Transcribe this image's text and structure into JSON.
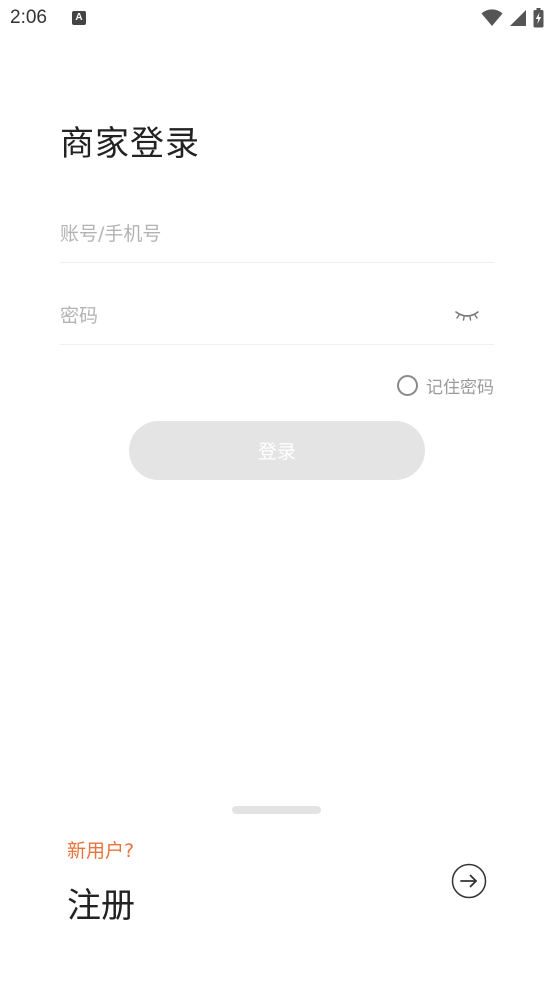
{
  "status_bar": {
    "time": "2:06",
    "notification_icon": "A"
  },
  "title": "商家登录",
  "account_field": {
    "placeholder": "账号/手机号",
    "value": ""
  },
  "password_field": {
    "placeholder": "密码",
    "value": ""
  },
  "remember": {
    "label": "记住密码",
    "checked": false
  },
  "login_button": {
    "label": "登录"
  },
  "register": {
    "prompt": "新用户?",
    "title": "注册"
  },
  "colors": {
    "accent": "#e8743b",
    "button_disabled": "#e4e4e4",
    "placeholder": "#b3b3b3"
  },
  "icons": {
    "eye": "eye-closed-icon",
    "register_arrow": "arrow-right-circle-icon",
    "wifi": "wifi-icon",
    "signal": "signal-icon",
    "battery": "battery-charging-icon"
  }
}
